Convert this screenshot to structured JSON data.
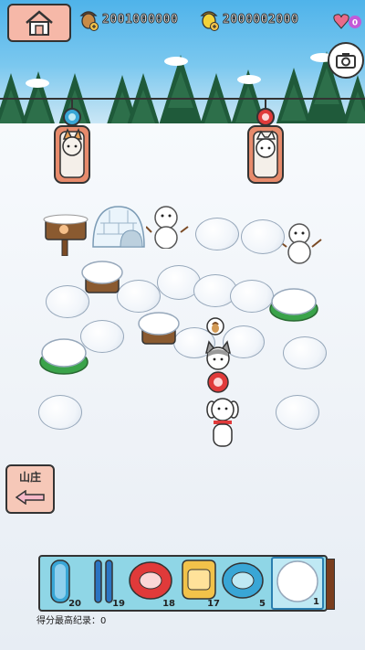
{
  "hud": {
    "acorn_brown_count": "2001000000",
    "acorn_gold_count": "2000002000",
    "heart_badge": "0"
  },
  "lodge_button": {
    "label": "山庄"
  },
  "inventory": {
    "slots": [
      {
        "name": "blue-sled",
        "count": "20"
      },
      {
        "name": "blue-skis",
        "count": "19"
      },
      {
        "name": "red-tube",
        "count": "18"
      },
      {
        "name": "yellow-seat",
        "count": "17"
      },
      {
        "name": "blue-tube",
        "count": "5"
      },
      {
        "name": "snowball",
        "count": "1"
      }
    ]
  },
  "highscore": {
    "label": "得分最高纪录：0"
  },
  "colors": {
    "accent": "#f6b8a8",
    "inventory_bg": "#8fd6e6",
    "red_item": "#e03a3a",
    "blue_item": "#39a6d6",
    "yellow_item": "#f2c24a"
  }
}
